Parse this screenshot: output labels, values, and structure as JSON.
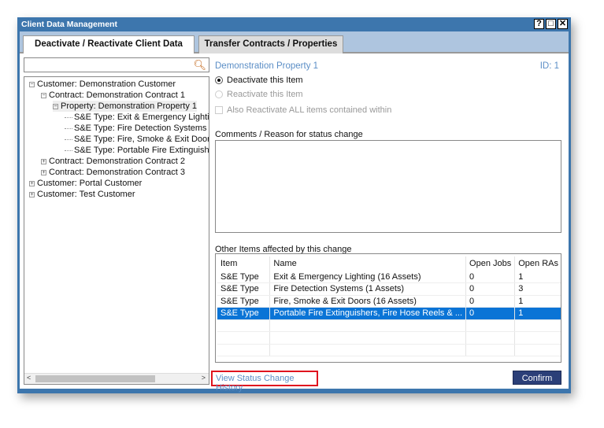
{
  "window": {
    "title": "Client Data Management",
    "help": "?",
    "maximize": "□",
    "close": "✕"
  },
  "tabs": [
    {
      "label": "Deactivate / Reactivate Client Data",
      "active": true
    },
    {
      "label": "Transfer Contracts / Properties",
      "active": false
    }
  ],
  "search": {
    "value": "",
    "placeholder": ""
  },
  "tree": [
    {
      "label": "Customer: Demonstration Customer",
      "exp": "−"
    },
    {
      "label": "Contract: Demonstration Contract 1",
      "exp": "−"
    },
    {
      "label": "Property: Demonstration Property 1",
      "exp": "−"
    },
    {
      "label": "S&E Type: Exit & Emergency Lighting"
    },
    {
      "label": "S&E Type: Fire Detection Systems"
    },
    {
      "label": "S&E Type: Fire, Smoke & Exit Doors"
    },
    {
      "label": "S&E Type: Portable Fire Extinguishers"
    },
    {
      "label": "Contract: Demonstration Contract 2",
      "exp": "+"
    },
    {
      "label": "Contract: Demonstration Contract 3",
      "exp": "+"
    },
    {
      "label": "Customer: Portal Customer",
      "exp": "+"
    },
    {
      "label": "Customer: Test Customer",
      "exp": "+"
    }
  ],
  "detail": {
    "title": "Demonstration Property 1",
    "id": "ID: 1",
    "deactivate": "Deactivate this Item",
    "reactivate": "Reactivate this Item",
    "also": "Also Reactivate ALL items contained within",
    "comments_label": "Comments / Reason for status change",
    "comments": "",
    "other_label": "Other Items affected by this change"
  },
  "table": {
    "headers": [
      "Item",
      "Name",
      "Open Jobs",
      "Open RAs"
    ],
    "rows": [
      [
        "S&E Type",
        "Exit & Emergency Lighting (16 Assets)",
        "0",
        "1"
      ],
      [
        "S&E Type",
        "Fire Detection Systems (1 Assets)",
        "0",
        "3"
      ],
      [
        "S&E Type",
        "Fire, Smoke & Exit Doors (16 Assets)",
        "0",
        "1"
      ],
      [
        "S&E Type",
        "Portable Fire Extinguishers, Fire Hose Reels & ...",
        "0",
        "1"
      ]
    ],
    "selected_row": 3
  },
  "footer": {
    "history_link": "View Status Change History",
    "confirm": "Confirm"
  },
  "colors": {
    "titlebar": "#3d76ad",
    "selection": "#0a74d6",
    "link": "#5b8ec6",
    "confirm": "#2b3f78",
    "highlight_box": "#e0141e"
  }
}
